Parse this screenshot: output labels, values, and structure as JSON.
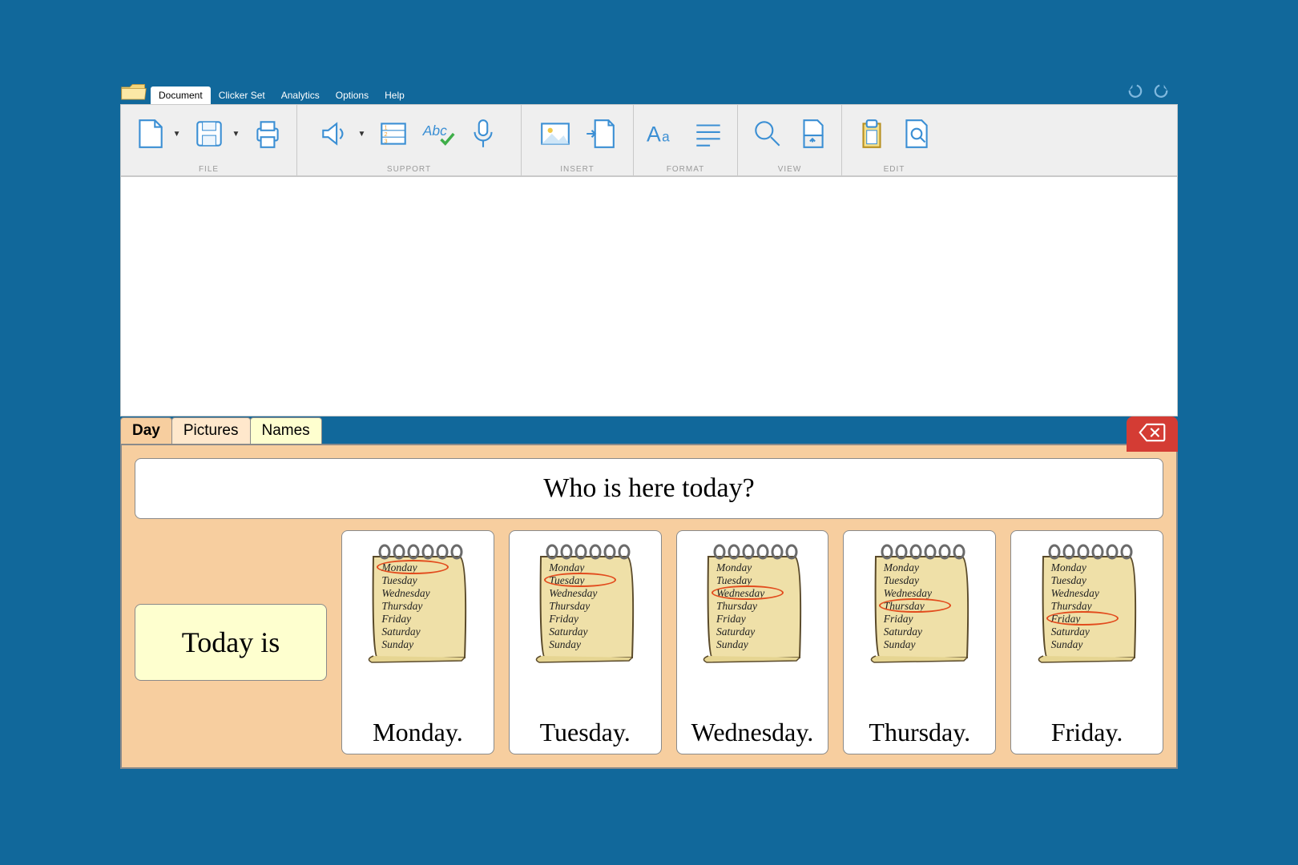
{
  "menu": {
    "tabs": [
      "Document",
      "Clicker Set",
      "Analytics",
      "Options",
      "Help"
    ],
    "active": 0
  },
  "ribbon": {
    "groups": [
      "FILE",
      "SUPPORT",
      "INSERT",
      "FORMAT",
      "VIEW",
      "EDIT"
    ]
  },
  "panel": {
    "tabs": [
      "Day",
      "Pictures",
      "Names"
    ],
    "active": 0,
    "question": "Who is here today?",
    "today_label": "Today is",
    "notepad_days": [
      "Monday",
      "Tuesday",
      "Wednesday",
      "Thursday",
      "Friday",
      "Saturday",
      "Sunday"
    ],
    "days": [
      {
        "label": "Monday.",
        "circle_index": 0
      },
      {
        "label": "Tuesday.",
        "circle_index": 1
      },
      {
        "label": "Wednesday.",
        "circle_index": 2
      },
      {
        "label": "Thursday.",
        "circle_index": 3
      },
      {
        "label": "Friday.",
        "circle_index": 4
      }
    ]
  }
}
